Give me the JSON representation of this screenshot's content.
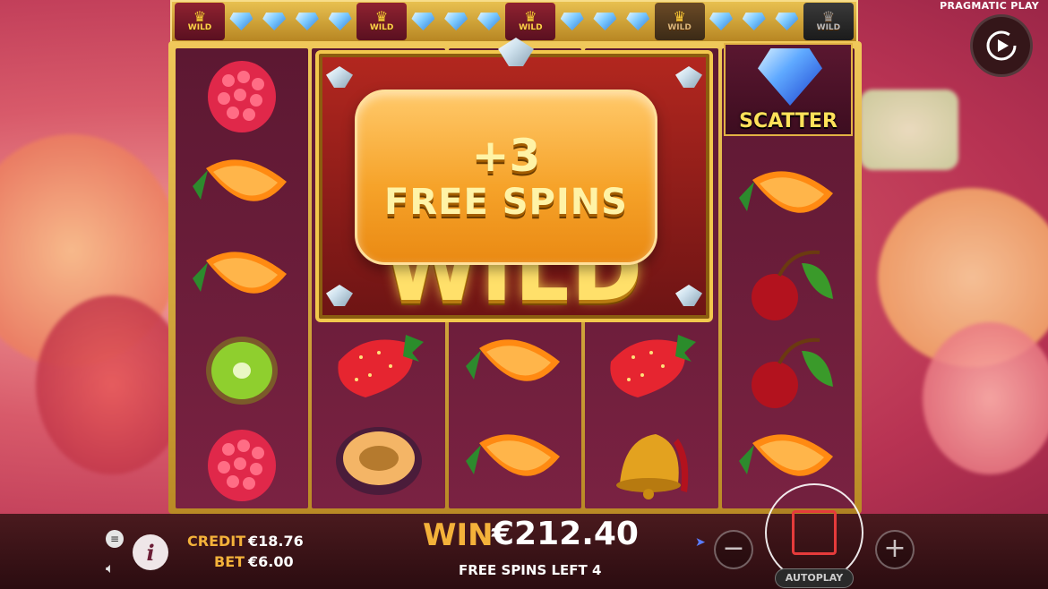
{
  "brand": "PRAGMATIC PLAY",
  "top_row": {
    "cells": [
      {
        "type": "wild",
        "label": "WILD",
        "style": "red"
      },
      {
        "type": "diamond"
      },
      {
        "type": "diamond"
      },
      {
        "type": "diamond"
      },
      {
        "type": "diamond"
      },
      {
        "type": "wild",
        "label": "WILD",
        "style": "red"
      },
      {
        "type": "diamond"
      },
      {
        "type": "diamond"
      },
      {
        "type": "diamond"
      },
      {
        "type": "wild",
        "label": "WILD",
        "style": "red"
      },
      {
        "type": "diamond"
      },
      {
        "type": "diamond"
      },
      {
        "type": "diamond"
      },
      {
        "type": "wild",
        "label": "WILD",
        "style": "gold"
      },
      {
        "type": "diamond"
      },
      {
        "type": "diamond"
      },
      {
        "type": "diamond"
      },
      {
        "type": "wild",
        "label": "WILD",
        "style": "grey"
      }
    ]
  },
  "reels": [
    [
      "raspberry",
      "orange",
      "orange",
      "kiwi",
      "raspberry"
    ],
    [
      "wild",
      "wild",
      "wild",
      "strawberry",
      "plum"
    ],
    [
      "wild",
      "wild",
      "wild",
      "orange",
      "orange"
    ],
    [
      "wild",
      "wild",
      "wild",
      "strawberry",
      "bell"
    ],
    [
      "scatter",
      "orange",
      "cherry",
      "cherry",
      "orange"
    ]
  ],
  "big_wild": {
    "label": "WILD"
  },
  "scatter": {
    "label": "SCATTER"
  },
  "popup": {
    "plus": "+3",
    "text": "FREE SPINS"
  },
  "hud": {
    "credit_label": "CREDIT",
    "credit_value": "€18.76",
    "bet_label": "BET",
    "bet_value": "€6.00",
    "win_label": "WIN",
    "win_value": "€212.40",
    "free_spins_left": "FREE SPINS LEFT 4",
    "autoplay_label": "AUTOPLAY",
    "info_label": "i",
    "minus_label": "−",
    "plus_label": "+"
  },
  "colors": {
    "accent": "#f4b23a",
    "stop": "#e53b3b"
  }
}
